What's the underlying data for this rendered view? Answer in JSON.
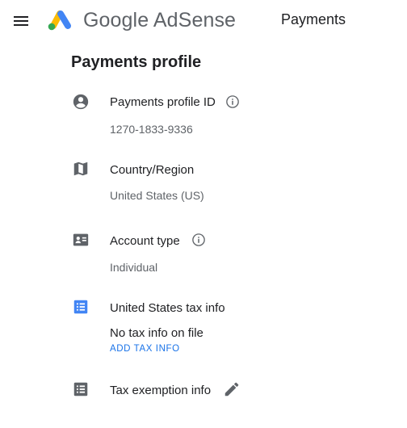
{
  "header": {
    "brand_google": "Google",
    "brand_product": "AdSense",
    "page_title": "Payments",
    "menu_icon": "hamburger-menu-icon",
    "logo_icon": "adsense-logo-icon"
  },
  "profile": {
    "title": "Payments profile",
    "rows": [
      {
        "icon": "account-circle-icon",
        "label": "Payments profile ID",
        "value": "1270-1833-9336",
        "info_icon": "info-outline-icon"
      },
      {
        "icon": "map-icon",
        "label": "Country/Region",
        "value": "United States (US)"
      },
      {
        "icon": "contact-card-icon",
        "label": "Account type",
        "value": "Individual",
        "info_icon": "info-outline-icon"
      },
      {
        "icon": "list-alt-icon",
        "label": "United States tax info",
        "value": "No tax info on file",
        "action": "ADD TAX INFO"
      },
      {
        "icon": "list-alt-icon",
        "label": "Tax exemption info",
        "action_icon": "pencil-edit-icon"
      }
    ]
  },
  "colors": {
    "text_primary": "#202124",
    "text_secondary": "#5f6368",
    "link": "#1a73e8",
    "icon_blue": "#4285f4",
    "logo_yellow": "#fbbc04",
    "logo_blue": "#4285f4",
    "logo_green": "#34a853"
  }
}
